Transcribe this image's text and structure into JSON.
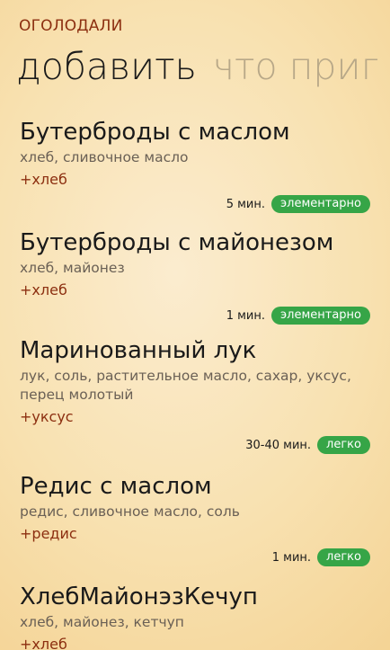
{
  "header": {
    "app_title": "ОГОЛОДАЛИ",
    "pivot_active": "добавить",
    "pivot_next": "что приг"
  },
  "recipes": [
    {
      "title": "Бутерброды с маслом",
      "ingredients": "хлеб, сливочное масло",
      "extra": "+хлеб",
      "time": "5 мин.",
      "difficulty": "элементарно"
    },
    {
      "title": "Бутерброды с майонезом",
      "ingredients": "хлеб, майонез",
      "extra": "+хлеб",
      "time": "1 мин.",
      "difficulty": "элементарно"
    },
    {
      "title": "Маринованный лук",
      "ingredients": "лук, соль, растительное масло, сахар, уксус, перец молотый",
      "extra": "+уксус",
      "time": "30-40 мин.",
      "difficulty": "легко"
    },
    {
      "title": "Редис с маслом",
      "ingredients": "редис, сливочное масло, соль",
      "extra": "+редис",
      "time": "1 мин.",
      "difficulty": "легко"
    },
    {
      "title": "ХлебМайонэзКечуп",
      "ingredients": "хлеб, майонез, кетчуп",
      "extra": "+хлеб"
    }
  ],
  "colors": {
    "accent": "#8c2f10",
    "badge": "#36a547",
    "background": "#f8e1b0"
  }
}
